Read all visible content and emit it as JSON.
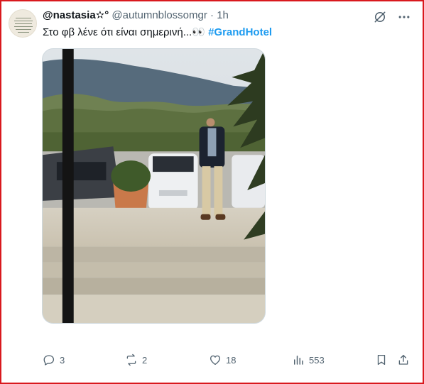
{
  "tweet": {
    "display_name": "@nastasia✫°",
    "handle": "@autumnblossomgr",
    "separator": "·",
    "time": "1h",
    "text": "Στο φβ λένε ότι είναι σημερινή...👀 ",
    "hashtag": "#GrandHotel"
  },
  "actions": {
    "replies": "3",
    "reposts": "2",
    "likes": "18",
    "views": "553"
  },
  "icons": {
    "top": [
      "grok-icon",
      "more-icon"
    ],
    "actions": [
      "reply-icon",
      "repost-icon",
      "like-icon",
      "views-icon",
      "bookmark-icon",
      "share-icon"
    ]
  },
  "colors": {
    "accent": "#1d9bf0",
    "muted": "#536471",
    "frame": "#d9191e"
  }
}
